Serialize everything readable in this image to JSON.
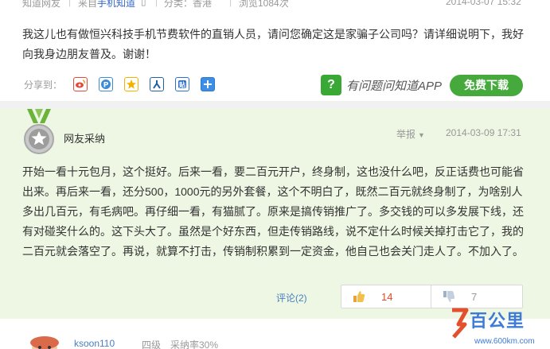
{
  "meta": {
    "source": "知道网友",
    "from_label": "来自",
    "from_app": "手机知道",
    "category": "分类：香港",
    "views": "浏览1084次",
    "time": "2014-03-07 15:32"
  },
  "question": {
    "text": "我这儿也有做恒兴科技手机节费软件的直销人员，请问您确定这是家骗子公司吗？请详细说明下，我好向我身边朋友普及。谢谢！"
  },
  "share": {
    "label": "分享到：",
    "icons": [
      "weibo-icon",
      "qzone-icon",
      "qq-icon",
      "renren-icon",
      "tieba-icon",
      "plus-icon"
    ]
  },
  "app_promo": {
    "text": "有问题问知道APP",
    "button": "免费下载"
  },
  "answer": {
    "author": "网友采纳",
    "report": "举报",
    "time": "2014-03-09 17:31",
    "text": "开始一看十元包月，这个挺好。后来一看，要二百元开户，终身制，这也没什么吧，反正话费也可能省出来。再后来一看，还分500，1000元的另外套餐，这个不明白了，既然二百元就终身制了，为啥别人多出几百元，有毛病吧。再仔细一看，有猫腻了。原来是搞传销推广了。多交钱的可以多发展下线，还有对碰奖什么的。这下头大了。虽然是个好东西，但走传销路线，说不定什么时候关掉打击它了，我的二百元就会落空了。再说，就算不打击，传销制积累到一定资金，他自己也会关门走人了。不加入了。",
    "comments": "评论(2)",
    "upvotes": "14",
    "downvotes": "7"
  },
  "next_answer": {
    "user": "ksoon110",
    "level": "四级",
    "rate": "采纳率30%"
  },
  "watermark": {
    "brand": "百公里",
    "url": "www.600km.com"
  },
  "colors": {
    "answer_bg": "#eef7e3",
    "accent_green": "#45a93c",
    "link_blue": "#4a7fbf",
    "upvote_red": "#e04b2a"
  }
}
